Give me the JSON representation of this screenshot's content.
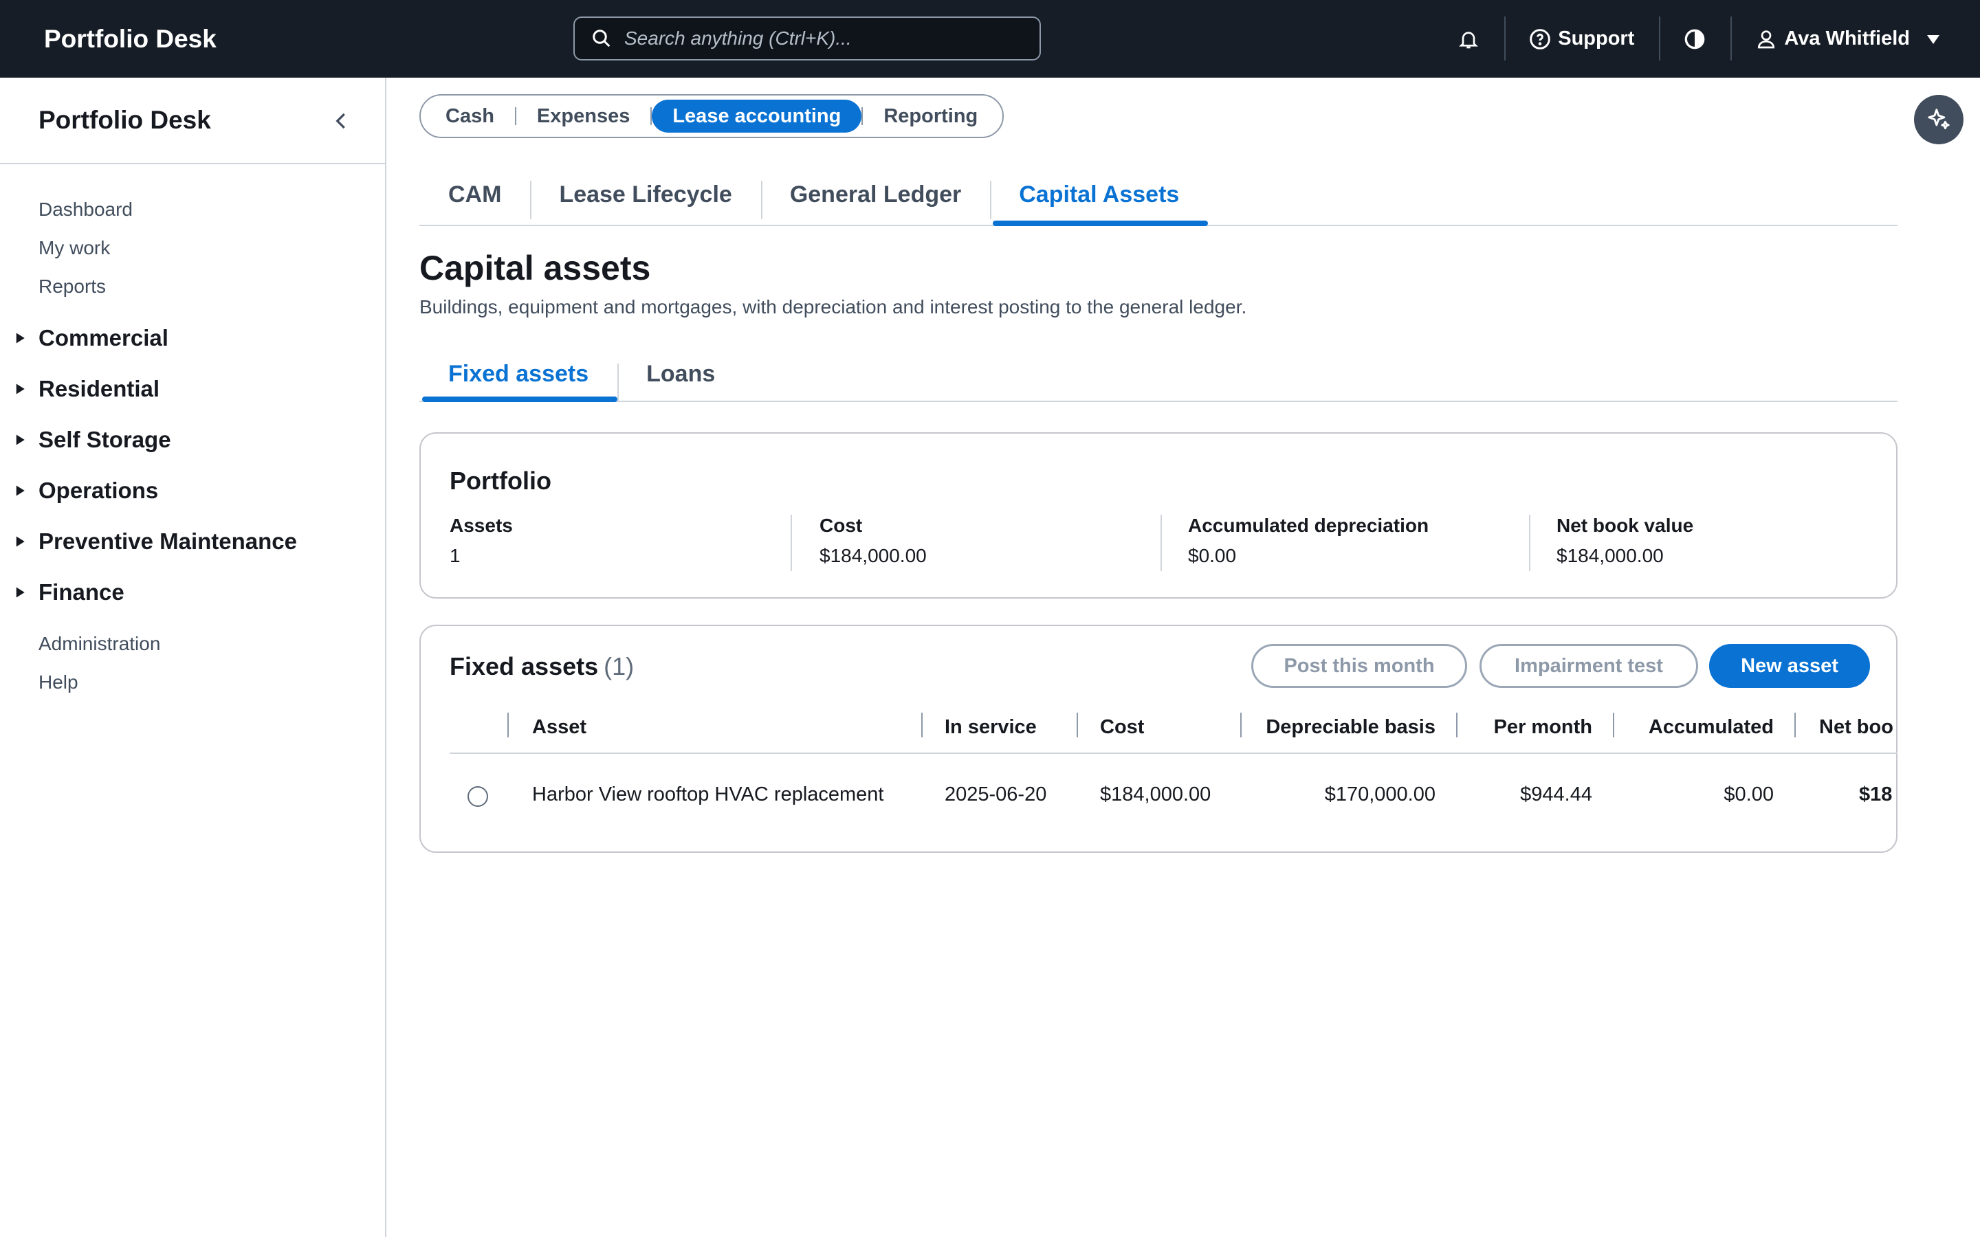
{
  "topbar": {
    "brand": "Portfolio Desk",
    "search_placeholder": "Search anything (Ctrl+K)...",
    "support_label": "Support",
    "user_name": "Ava Whitfield"
  },
  "sidebar": {
    "title": "Portfolio Desk",
    "top_links": [
      "Dashboard",
      "My work",
      "Reports"
    ],
    "groups": [
      "Commercial",
      "Residential",
      "Self Storage",
      "Operations",
      "Preventive Maintenance",
      "Finance"
    ],
    "bottom_links": [
      "Administration",
      "Help"
    ]
  },
  "segmented": {
    "items": [
      "Cash",
      "Expenses",
      "Lease accounting",
      "Reporting"
    ],
    "active": "Lease accounting"
  },
  "tabs": {
    "items": [
      "CAM",
      "Lease Lifecycle",
      "General Ledger",
      "Capital Assets"
    ],
    "active": "Capital Assets"
  },
  "page": {
    "title": "Capital assets",
    "description": "Buildings, equipment and mortgages, with depreciation and interest posting to the general ledger."
  },
  "subtabs": {
    "items": [
      "Fixed assets",
      "Loans"
    ],
    "active": "Fixed assets"
  },
  "portfolio": {
    "title": "Portfolio",
    "metrics": [
      {
        "label": "Assets",
        "value": "1"
      },
      {
        "label": "Cost",
        "value": "$184,000.00"
      },
      {
        "label": "Accumulated depreciation",
        "value": "$0.00"
      },
      {
        "label": "Net book value",
        "value": "$184,000.00"
      }
    ]
  },
  "fixed_assets": {
    "title": "Fixed assets",
    "count": "(1)",
    "buttons": {
      "post": "Post this month",
      "impairment": "Impairment test",
      "new": "New asset"
    },
    "columns": [
      "Asset",
      "In service",
      "Cost",
      "Depreciable basis",
      "Per month",
      "Accumulated",
      "Net boo"
    ],
    "rows": [
      {
        "asset": "Harbor View rooftop HVAC replacement",
        "in_service": "2025-06-20",
        "cost": "$184,000.00",
        "depreciable_basis": "$170,000.00",
        "per_month": "$944.44",
        "accumulated": "$0.00",
        "net_book": "$18"
      }
    ]
  },
  "colors": {
    "topbar_bg": "#161d26",
    "accent": "#0972d3",
    "text": "#16191f",
    "muted": "#414d5c"
  }
}
